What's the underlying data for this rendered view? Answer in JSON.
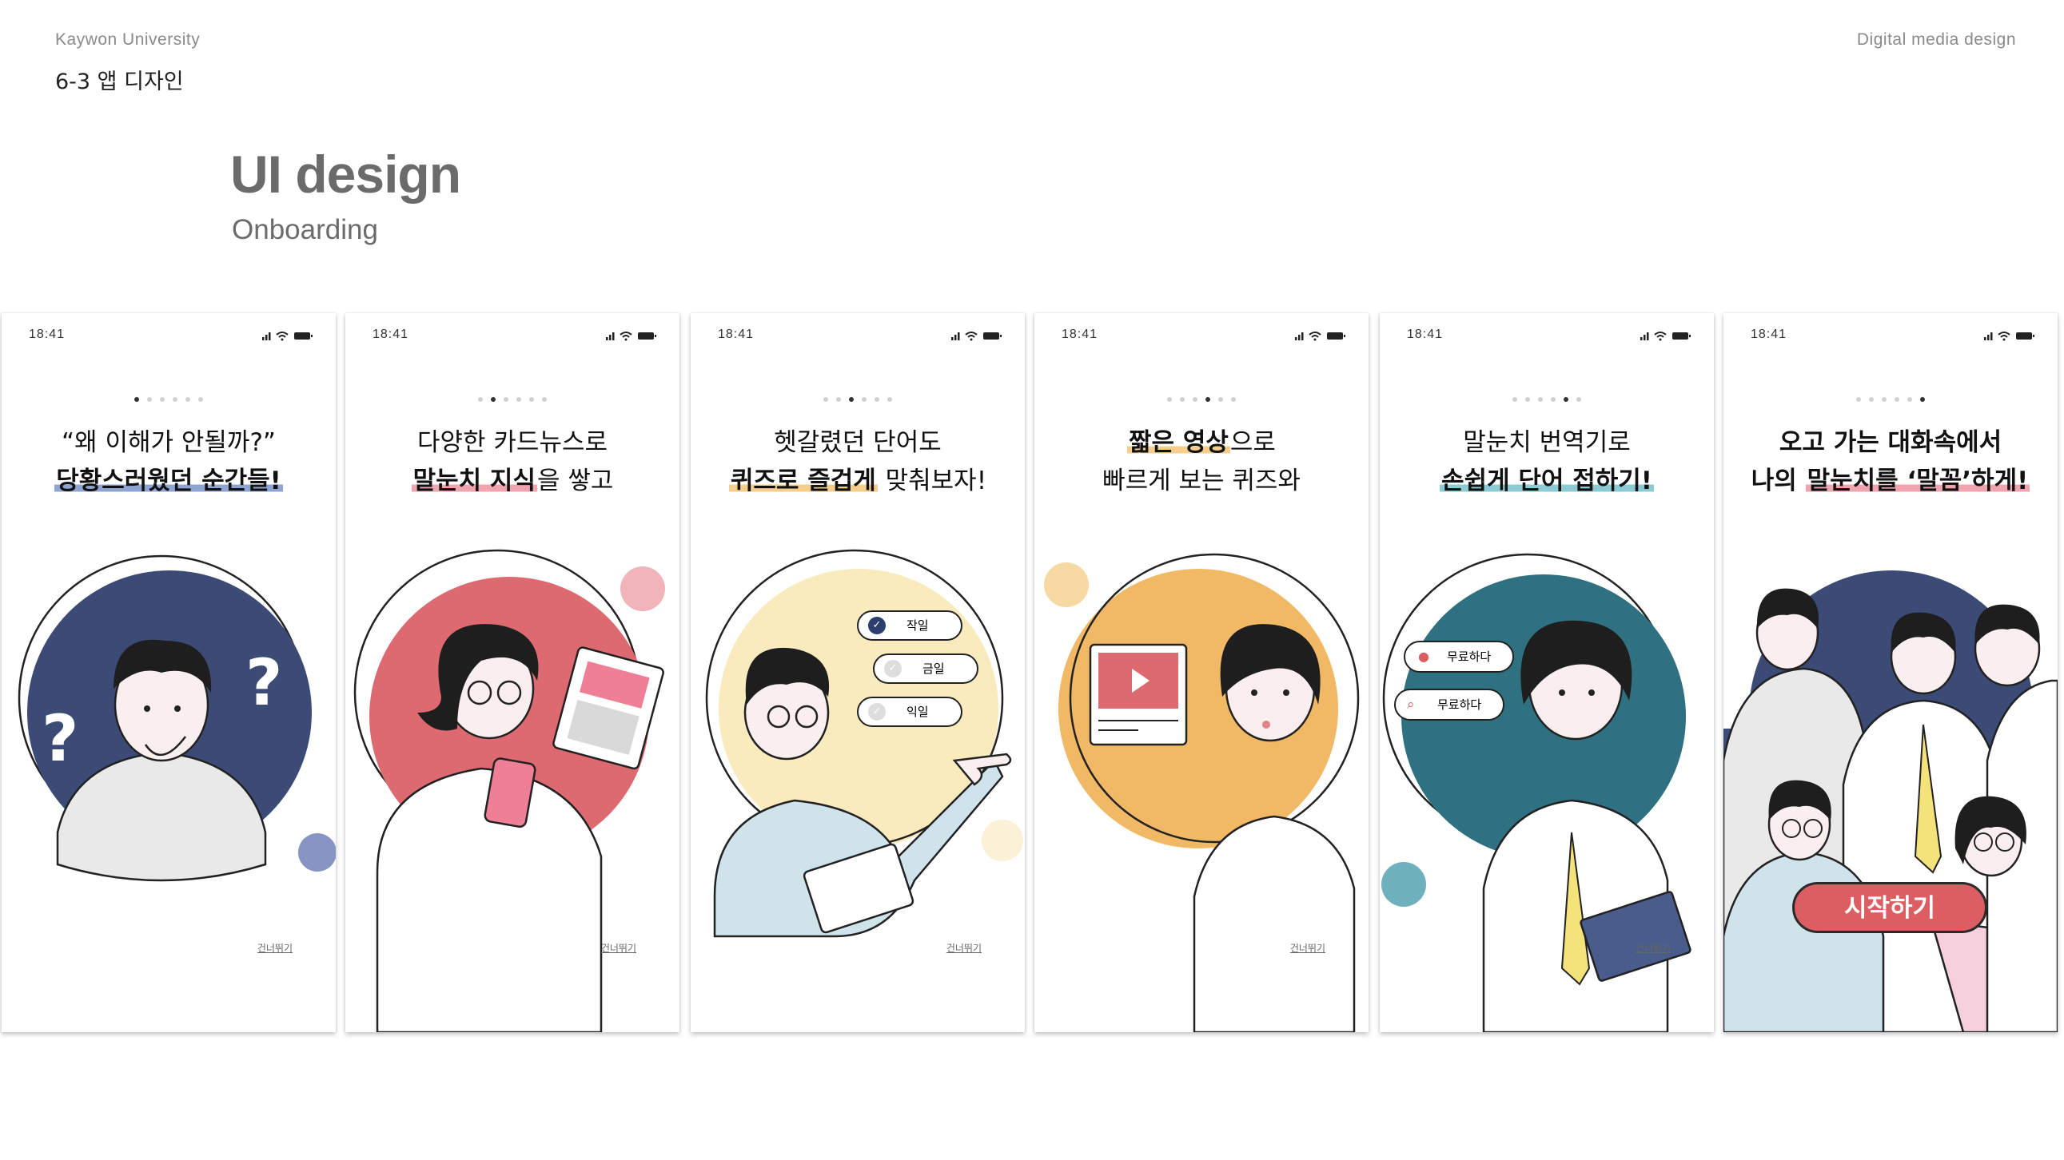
{
  "header": {
    "university": "Kaywon University",
    "course": "6-3 앱 디자인",
    "department": "Digital media design"
  },
  "section": {
    "title": "UI design",
    "subtitle": "Onboarding"
  },
  "status_time": "18:41",
  "skip_label": "건너뛰기",
  "screens": [
    {
      "line1": "“왜 이해가 안될까?”",
      "line2": "당황스러웠던 순간들!",
      "active_dot": 1,
      "highlight_color": "#8ea4d2"
    },
    {
      "line1_a": "다양한 카드뉴스로",
      "line2_bold": "말눈치 지식",
      "line2_rest": "을 쌓고",
      "active_dot": 2,
      "highlight_color": "#f1a4ae"
    },
    {
      "line1": "헷갈렸던 단어도",
      "line2_bold": "퀴즈로 즐겁게",
      "line2_rest": " 맞춰보자!",
      "active_dot": 3,
      "quiz_options": [
        "작일",
        "금일",
        "익일"
      ],
      "highlight_color": "#f7cd8c"
    },
    {
      "line1_bold": "짧은 영상",
      "line1_rest": "으로",
      "line2": "빠르게 보는 퀴즈와",
      "active_dot": 4,
      "highlight_color": "#f7cd8c"
    },
    {
      "line1": "말눈치 번역기로",
      "line2": "손쉽게 단어 접하기!",
      "active_dot": 5,
      "chips": [
        "무료하다",
        "무료하다"
      ],
      "highlight_color": "#8ccbd3"
    },
    {
      "line1": "오고 가는 대화속에서",
      "line2_a": "나의 ",
      "line2_hl": "말눈치를 ‘말꼼’하게!",
      "active_dot": 6,
      "start_label": "시작하기",
      "highlight_color": "#f1a4ae"
    }
  ],
  "colors": {
    "navy": "#3c4a76",
    "red": "#dc6a70",
    "pale_yellow": "#f9ebbd",
    "orange": "#f1b866",
    "teal": "#2f7180",
    "button": "#dc5e62"
  }
}
